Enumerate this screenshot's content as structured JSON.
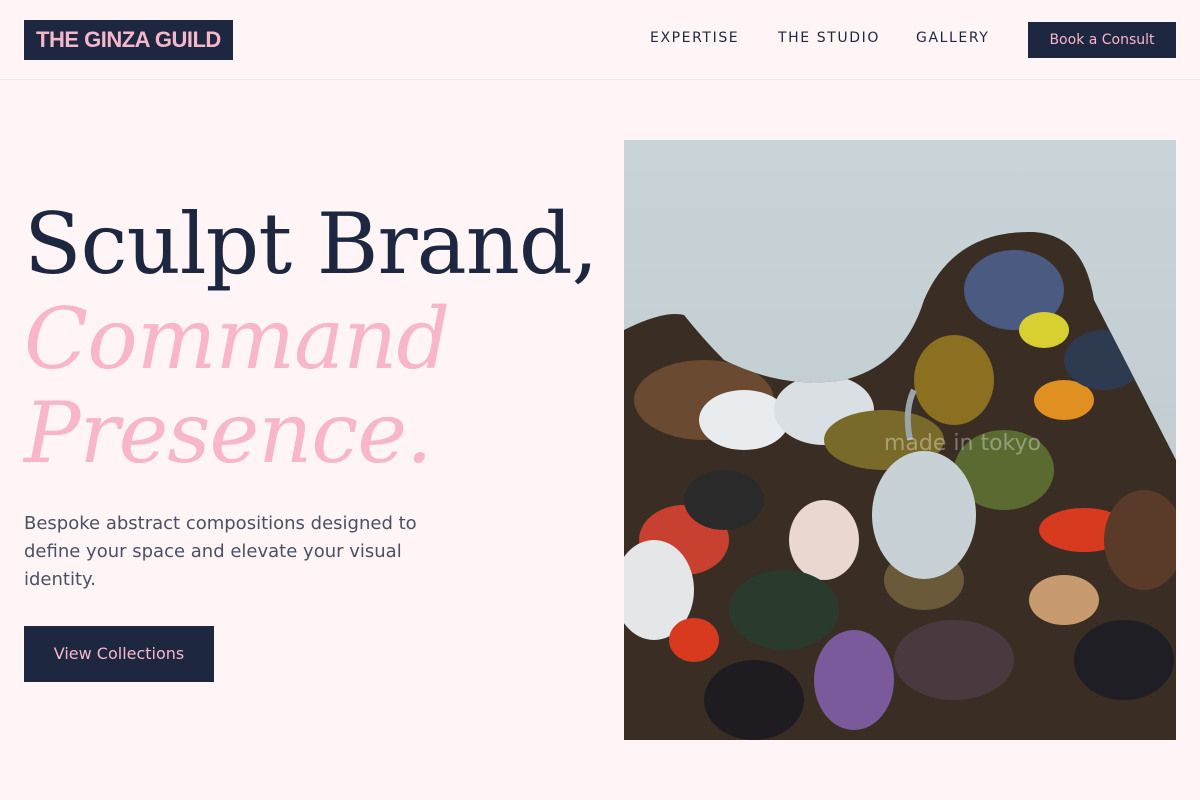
{
  "header": {
    "logo": "THE GINZA GUILD",
    "nav": [
      {
        "label": "EXPERTISE"
      },
      {
        "label": "THE STUDIO"
      },
      {
        "label": "GALLERY"
      }
    ],
    "cta": "Book a Consult"
  },
  "hero": {
    "title_line1": "Sculpt Brand,",
    "title_line2": "Command",
    "title_line3": "Presence.",
    "description": "Bespoke abstract compositions designed to define your space and elevate your visual identity.",
    "button": "View Collections",
    "image": {
      "subject": "paint-palette",
      "watermark": "made in tokyo"
    }
  },
  "colors": {
    "background": "#fff5f6",
    "navy": "#1e2740",
    "pink": "#f7b6c9",
    "body_text": "#4b5063"
  }
}
